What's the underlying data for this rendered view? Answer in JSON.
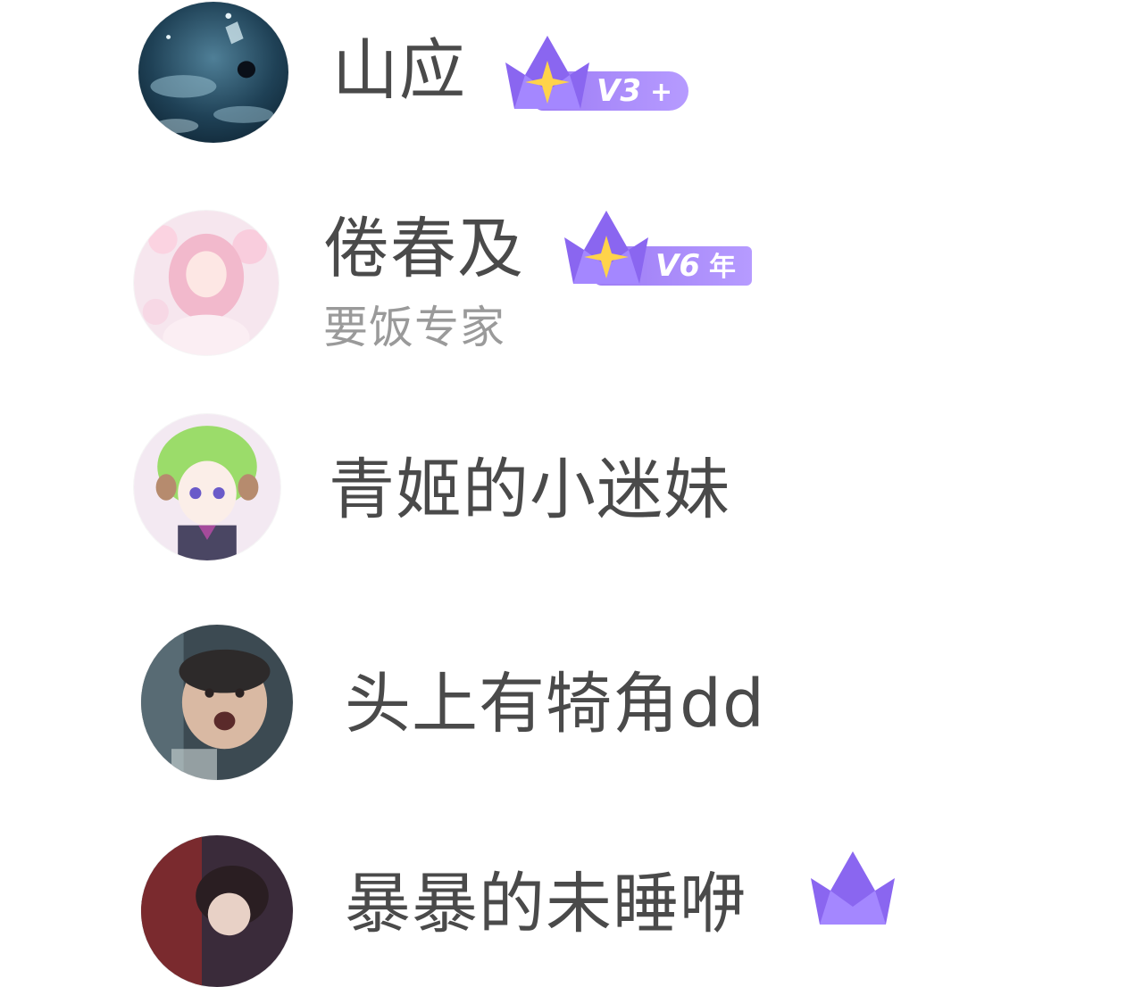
{
  "users": [
    {
      "name": "山应",
      "vip_level": "V3",
      "vip_suffix": "+",
      "subtitle": ""
    },
    {
      "name": "倦春及",
      "vip_level": "V6",
      "vip_suffix": "年",
      "subtitle": "要饭专家"
    },
    {
      "name": "青姬的小迷妹",
      "vip_level": "",
      "vip_suffix": "",
      "subtitle": ""
    },
    {
      "name": "头上有犄角dd",
      "vip_level": "",
      "vip_suffix": "",
      "subtitle": ""
    },
    {
      "name": "暴暴的未睡咿",
      "vip_level": "",
      "vip_suffix": "",
      "subtitle": ""
    }
  ],
  "colors": {
    "name_text": "#4a4a4a",
    "subtitle_text": "#9a9a9a",
    "vip_purple": "#9d7cf5",
    "crown_star": "#ffd34a"
  },
  "icons": {
    "vip_badge": "crown-icon"
  }
}
